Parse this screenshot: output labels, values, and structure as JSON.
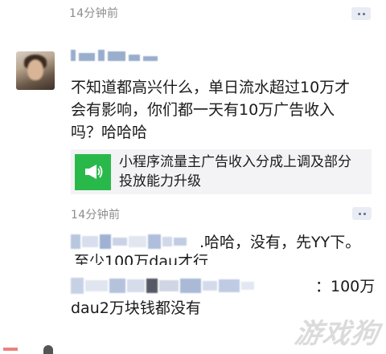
{
  "post1": {
    "timestamp": "14分钟前"
  },
  "comment1": {
    "text_line1": "不知道都高兴什么，单日流水超过10万才",
    "text_line2": "会有影响，你们都一天有10万广告收入",
    "text_line3": "吗？哈哈哈"
  },
  "link_card": {
    "title_line1": "小程序流量主广告收入分成上调及部分",
    "title_line2": "投放能力升级",
    "icon": "megaphone-icon",
    "icon_color": "#29b94b"
  },
  "post2": {
    "timestamp": "14分钟前",
    "reply1": ".哈哈，没有，先YY下。",
    "reply1_line2": "至少100万dau才行",
    "reply2_tail": "：100万",
    "reply2_line2": "dau2万块钱都没有"
  },
  "watermark": {
    "text": "游戏狗"
  },
  "colors": {
    "timestamp": "#8c8c8c",
    "blur_name": "#8fa6c8",
    "card_bg": "#f3f3f5"
  }
}
